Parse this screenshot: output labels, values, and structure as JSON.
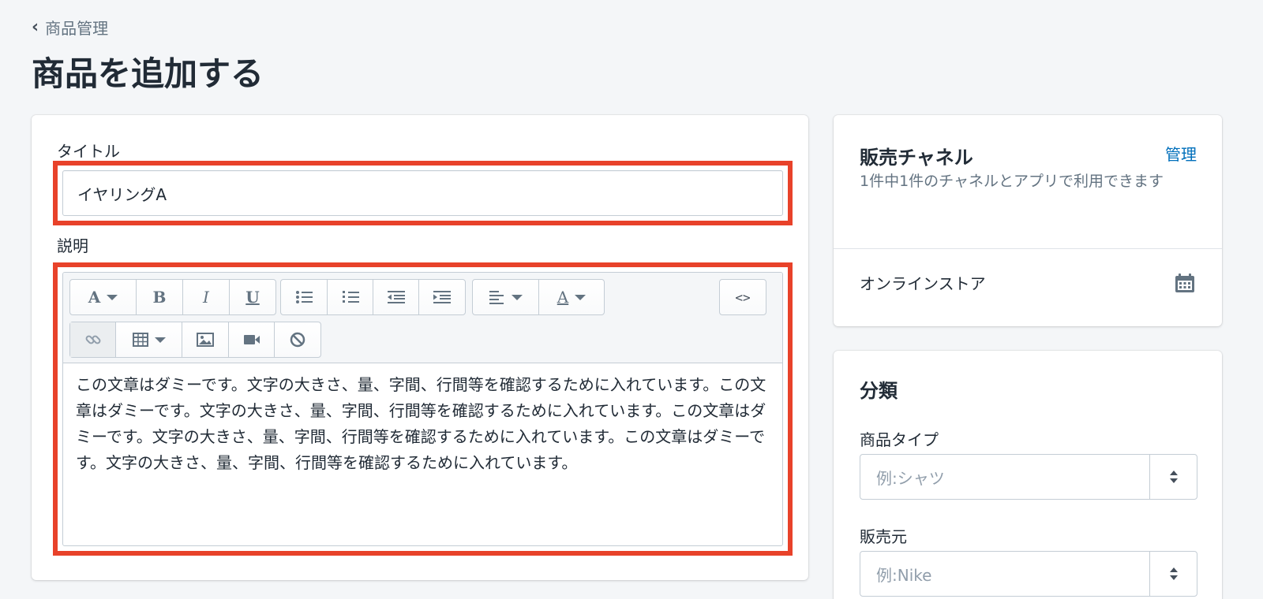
{
  "breadcrumb": {
    "label": "商品管理"
  },
  "page": {
    "title": "商品を追加する"
  },
  "form": {
    "title_label": "タイトル",
    "title_value": "イヤリングA",
    "description_label": "説明",
    "description_text": "この文章はダミーです。文字の大きさ、量、字間、行間等を確認するために入れています。この文章はダミーです。文字の大きさ、量、字間、行間等を確認するために入れています。この文章はダミーです。文字の大きさ、量、字間、行間等を確認するために入れています。この文章はダミーです。文字の大きさ、量、字間、行間等を確認するために入れています。"
  },
  "toolbar": {
    "font_glyph": "A",
    "bold_glyph": "B",
    "italic_glyph": "I",
    "underline_glyph": "U",
    "color_glyph": "A",
    "code_glyph": "<>"
  },
  "sales_channels": {
    "heading": "販売チャネル",
    "manage_link": "管理",
    "description": "1件中1件のチャネルとアプリで利用できます",
    "channel_name": "オンラインストア"
  },
  "classification": {
    "heading": "分類",
    "product_type_label": "商品タイプ",
    "product_type_placeholder": "例:シャツ",
    "vendor_label": "販売元",
    "vendor_placeholder": "例:Nike"
  },
  "colors": {
    "highlight": "#e8422a",
    "link": "#006fbb"
  }
}
